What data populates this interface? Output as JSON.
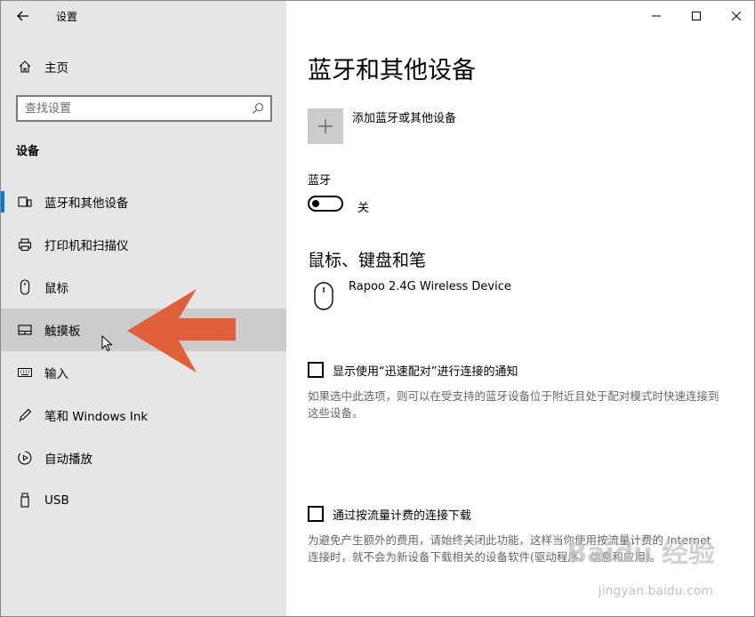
{
  "window": {
    "title": "设置"
  },
  "sidebar": {
    "home_label": "主页",
    "search_placeholder": "查找设置",
    "section_title": "设备",
    "items": [
      {
        "label": "蓝牙和其他设备",
        "icon": "bluetooth-devices-icon",
        "selected": true
      },
      {
        "label": "打印机和扫描仪",
        "icon": "printer-icon"
      },
      {
        "label": "鼠标",
        "icon": "mouse-icon"
      },
      {
        "label": "触摸板",
        "icon": "touchpad-icon",
        "hovered": true
      },
      {
        "label": "输入",
        "icon": "keyboard-icon"
      },
      {
        "label": "笔和 Windows Ink",
        "icon": "pen-icon"
      },
      {
        "label": "自动播放",
        "icon": "autoplay-icon"
      },
      {
        "label": "USB",
        "icon": "usb-icon"
      }
    ]
  },
  "main": {
    "page_title": "蓝牙和其他设备",
    "add_device_label": "添加蓝牙或其他设备",
    "bluetooth_label": "蓝牙",
    "bluetooth_state": "关",
    "section_mouse": "鼠标、键盘和笔",
    "device_name": "Rapoo 2.4G Wireless Device",
    "swift_pair_label": "显示使用“迅速配对”进行连接的通知",
    "swift_pair_desc": "如果选中此选项，则可以在受支持的蓝牙设备位于附近且处于配对模式时快速连接到这些设备。",
    "metered_label": "通过按流量计费的连接下载",
    "metered_desc": "为避免产生额外的费用，请始终关闭此功能，这样当你使用按流量计费的 Internet 连接时，就不会为新设备下载相关的设备软件(驱动程序、信息和应用)。"
  },
  "colors": {
    "accent": "#0078d7",
    "sidebar_bg": "#e6e6e6",
    "overlay_arrow": "#e0603a"
  },
  "watermark": {
    "brand": "Baidu 经验",
    "url": "jingyan.baidu.com"
  }
}
